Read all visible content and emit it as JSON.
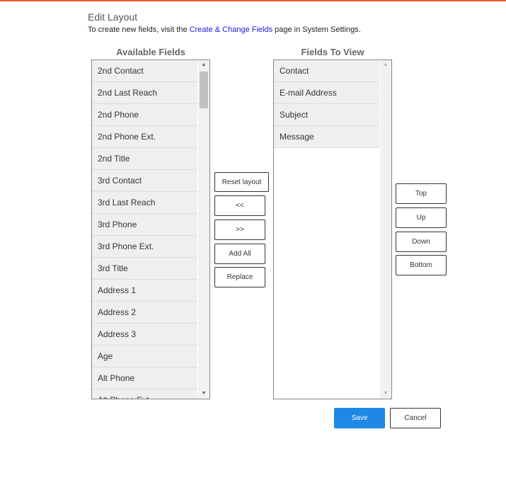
{
  "header": {
    "title": "Edit Layout",
    "intro_before": "To create new fields, visit the ",
    "intro_link": "Create & Change Fields",
    "intro_after": " page in System Settings."
  },
  "available": {
    "heading": "Available Fields",
    "items": [
      "2nd Contact",
      "2nd Last Reach",
      "2nd Phone",
      "2nd Phone Ext.",
      "2nd Title",
      "3rd Contact",
      "3rd Last Reach",
      "3rd Phone",
      "3rd Phone Ext.",
      "3rd Title",
      "Address 1",
      "Address 2",
      "Address 3",
      "Age",
      "Alt Phone",
      "Alt Phone Ext."
    ]
  },
  "view": {
    "heading": "Fields To View",
    "items": [
      "Contact",
      "E-mail Address",
      "Subject",
      "Message"
    ]
  },
  "transfer_buttons": {
    "reset": "Reset layout",
    "move_left": "<<",
    "move_right": ">>",
    "add_all": "Add All",
    "replace": "Replace"
  },
  "order_buttons": {
    "top": "Top",
    "up": "Up",
    "down": "Down",
    "bottom": "Bottom"
  },
  "footer": {
    "save": "Save",
    "cancel": "Cancel"
  },
  "colors": {
    "accent_bar": "#e8572a",
    "primary": "#1e88e5",
    "link": "#1a1adb"
  }
}
